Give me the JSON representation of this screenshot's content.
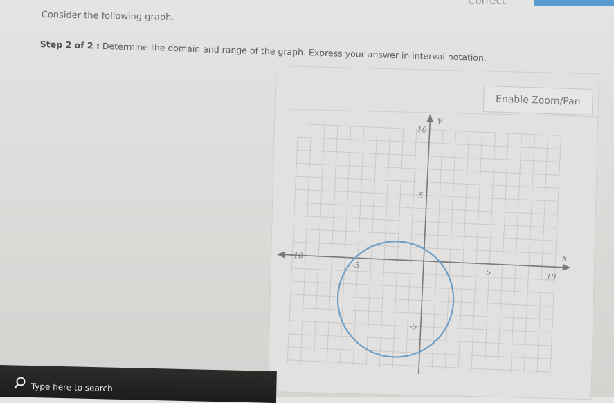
{
  "header": {
    "status_text": "Correct"
  },
  "question": {
    "prompt": "Consider the following graph.",
    "step_label": "Step 2 of 2 :",
    "step_text": "Determine the domain and range of the graph. Express your answer in interval notation."
  },
  "toolbar": {
    "zoom_pan_label": "Enable Zoom/Pan"
  },
  "graph": {
    "x_axis_label": "x",
    "y_axis_label": "y",
    "tick_labels": {
      "x_neg10": "-10",
      "x_neg5": "-5",
      "x_pos5": "5",
      "x_pos10": "10",
      "y_pos10": "10",
      "y_pos5": "5",
      "y_neg5": "-5"
    },
    "circle": {
      "center": [
        -2,
        -3
      ],
      "radius": 4
    },
    "colors": {
      "grid": "#c9c9c9",
      "axis": "#7a7a7a",
      "curve": "#6f9fc8"
    }
  },
  "taskbar": {
    "search_placeholder": "Type here to search",
    "search_icon": "search-icon"
  }
}
